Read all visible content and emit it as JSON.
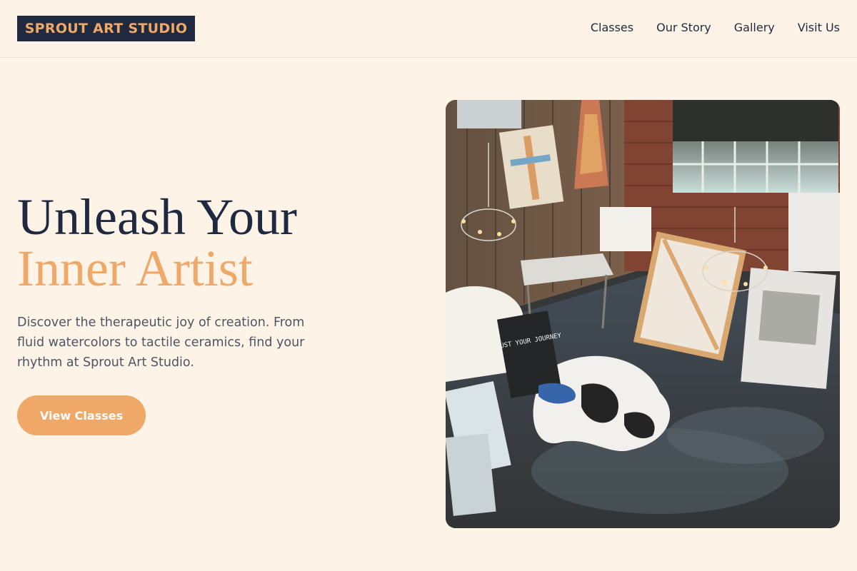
{
  "brand": {
    "name": "SPROUT ART STUDIO"
  },
  "nav": {
    "items": [
      {
        "label": "Classes"
      },
      {
        "label": "Our Story"
      },
      {
        "label": "Gallery"
      },
      {
        "label": "Visit Us"
      }
    ]
  },
  "hero": {
    "title_line1": "Unleash Your",
    "title_line2": "Inner Artist",
    "description": "Discover the therapeutic joy of creation. From fluid watercolors to tactile ceramics, find your rhythm at Sprout Art Studio.",
    "cta_label": "View Classes",
    "canvas_text": "TRUST YOUR JOURNEY"
  },
  "colors": {
    "background": "#fdf3e7",
    "navy": "#1f2a40",
    "accent": "#f0a868",
    "body_text": "#4e5563"
  }
}
